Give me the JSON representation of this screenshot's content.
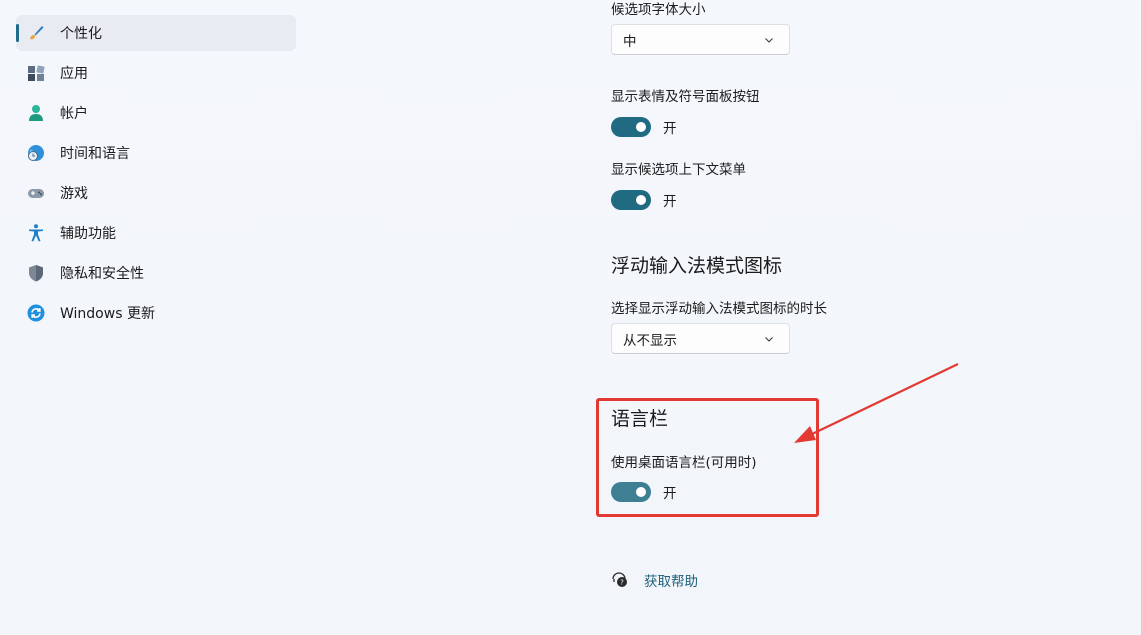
{
  "sidebar": {
    "items": [
      {
        "label": "个性化",
        "icon": "personalization-brush-icon",
        "selected": true
      },
      {
        "label": "应用",
        "icon": "apps-icon"
      },
      {
        "label": "帐户",
        "icon": "account-person-icon"
      },
      {
        "label": "时间和语言",
        "icon": "time-language-globe-icon"
      },
      {
        "label": "游戏",
        "icon": "gamepad-icon"
      },
      {
        "label": "辅助功能",
        "icon": "accessibility-icon"
      },
      {
        "label": "隐私和安全性",
        "icon": "shield-icon"
      },
      {
        "label": "Windows 更新",
        "icon": "windows-update-icon"
      }
    ]
  },
  "main": {
    "font_size_label": "候选项字体大小",
    "font_size_value": "中",
    "emoji_button_label": "显示表情及符号面板按钮",
    "emoji_button_state": "开",
    "context_menu_label": "显示候选项上下文菜单",
    "context_menu_state": "开",
    "floating_section_title": "浮动输入法模式图标",
    "floating_duration_label": "选择显示浮动输入法模式图标的时长",
    "floating_duration_value": "从不显示",
    "language_bar_title": "语言栏",
    "language_bar_label": "使用桌面语言栏(可用时)",
    "language_bar_state": "开",
    "help_label": "获取帮助"
  },
  "colors": {
    "toggle_on": "#206b82",
    "annotation_red": "#e23a33",
    "link": "#1f5f7a"
  }
}
